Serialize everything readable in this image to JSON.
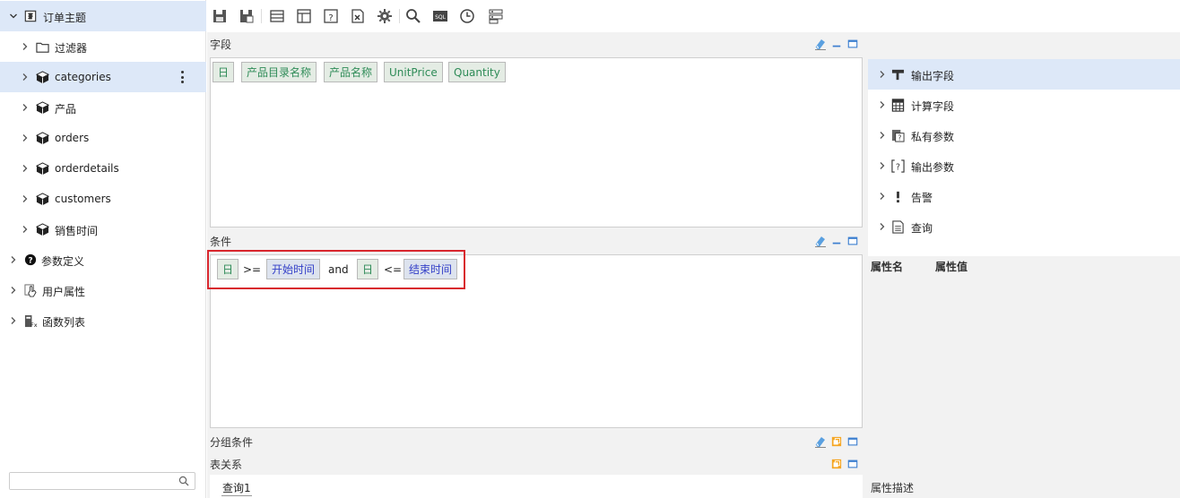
{
  "tree": {
    "root": {
      "label": "订单主题",
      "icon": "theme-icon"
    },
    "items": [
      {
        "label": "过滤器",
        "icon": "folder-icon"
      },
      {
        "label": "categories",
        "icon": "cube-icon"
      },
      {
        "label": "产品",
        "icon": "cube-icon"
      },
      {
        "label": "orders",
        "icon": "cube-icon"
      },
      {
        "label": "orderdetails",
        "icon": "cube-icon"
      },
      {
        "label": "customers",
        "icon": "cube-icon"
      },
      {
        "label": "销售时间",
        "icon": "cube-icon"
      }
    ],
    "top_nodes": [
      {
        "label": "参数定义",
        "icon": "question-circle-icon"
      },
      {
        "label": "用户属性",
        "icon": "user-attr-icon"
      },
      {
        "label": "函数列表",
        "icon": "function-icon"
      }
    ],
    "search_placeholder": ""
  },
  "toolbar": {
    "buttons": [
      "save-icon",
      "save-as-icon",
      "table-icon",
      "layout-icon",
      "param-icon",
      "export-icon",
      "gear-icon",
      "search-icon",
      "sql-icon",
      "clock-icon",
      "settings-icon"
    ],
    "sql_text": "SQL"
  },
  "fields": {
    "title": "字段",
    "chips": [
      "日",
      "产品目录名称",
      "产品名称",
      "UnitPrice",
      "Quantity"
    ]
  },
  "conditions": {
    "title": "条件",
    "field1": "日",
    "op1": ">=",
    "value1": "开始时间",
    "joiner": "and",
    "field2": "日",
    "op2": "<=",
    "value2": "结束时间"
  },
  "group_conditions": {
    "title": "分组条件"
  },
  "table_relations": {
    "title": "表关系",
    "tab": "查询1"
  },
  "right": {
    "items": [
      {
        "label": "输出字段",
        "icon": "output-field-icon"
      },
      {
        "label": "计算字段",
        "icon": "calculator-icon"
      },
      {
        "label": "私有参数",
        "icon": "private-param-icon"
      },
      {
        "label": "输出参数",
        "icon": "output-param-icon"
      },
      {
        "label": "告警",
        "icon": "exclamation-icon"
      },
      {
        "label": "查询",
        "icon": "query-icon"
      }
    ],
    "prop_name": "属性名",
    "prop_value": "属性值",
    "prop_desc": "属性描述"
  },
  "colors": {
    "selected_bg": "#dde8f8",
    "chip_green_text": "#2e8b57",
    "chip_blue_text": "#3440c8",
    "highlight_border": "#d8262d"
  }
}
